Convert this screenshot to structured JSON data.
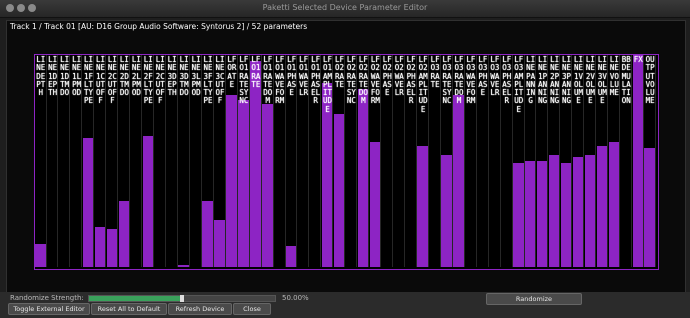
{
  "window": {
    "title": "Paketti Selected Device Parameter Editor"
  },
  "track_label": "Track 1 / Track 01 [AU: D16 Group Audio Software: Syntorus 2] / 52 parameters",
  "colors": {
    "accent": "#8d24c4",
    "background": "#000000",
    "slider_fill": "#3aa15b"
  },
  "parameters": [
    {
      "label": "LINE DEPTH",
      "value": 0.11
    },
    {
      "label": "LINE 1 DEPTH",
      "value": 0.0
    },
    {
      "label": "LINE 1 DTMDO",
      "value": 0.0
    },
    {
      "label": "LINE 1 LP MOD",
      "value": 0.0
    },
    {
      "label": "LINE 1 FLT TYPE",
      "value": 0.61
    },
    {
      "label": "LINE 1 CUTOFF",
      "value": 0.19
    },
    {
      "label": "LINE 2 CUTOFF",
      "value": 0.18
    },
    {
      "label": "LINE 2 DTMDO",
      "value": 0.31
    },
    {
      "label": "LINE 2 LP MOD",
      "value": 0.0
    },
    {
      "label": "LINE 2 FLT TYPE",
      "value": 0.62
    },
    {
      "label": "LINE 2 CUTOFF",
      "value": 0.0
    },
    {
      "label": "LINE 3 DEPTH",
      "value": 0.0
    },
    {
      "label": "LINE 3 DTMDO",
      "value": 0.01
    },
    {
      "label": "LINE 3 LP MOD",
      "value": 0.0
    },
    {
      "label": "LINE 3 FLT TYPE",
      "value": 0.31
    },
    {
      "label": "LINE 3 CUTOFF",
      "value": 0.22
    },
    {
      "label": "LFO RATE",
      "value": 0.81
    },
    {
      "label": "LFO 1 RATE SYNC",
      "value": 0.79
    },
    {
      "label": "LFO 1 RATE",
      "value": 0.97
    },
    {
      "label": "LFO 1 RATE DOM",
      "value": 0.77
    },
    {
      "label": "LFO 1 WAVEFORM",
      "value": 0.0
    },
    {
      "label": "LFO 1 PHASE",
      "value": 0.1
    },
    {
      "label": "LFO 1 WAVE LR",
      "value": 0.0
    },
    {
      "label": "LFO 1 PHASE LR",
      "value": 0.0
    },
    {
      "label": "LFO 1 AMPLITUDE",
      "value": 0.87
    },
    {
      "label": "LFO 2 RATE",
      "value": 0.72
    },
    {
      "label": "LFO 2 RATE SYNC",
      "value": 0.0
    },
    {
      "label": "LFO 2 RATE DOM",
      "value": 0.84
    },
    {
      "label": "LFO 2 WAVEFORM",
      "value": 0.59
    },
    {
      "label": "LFO 2 PHASE",
      "value": 0.0
    },
    {
      "label": "LFO 2 WAVE LR",
      "value": 0.0
    },
    {
      "label": "LFO 2 PHASE LR",
      "value": 0.0
    },
    {
      "label": "LFO 2 AMPLITUDE",
      "value": 0.57
    },
    {
      "label": "LFO 3 RATE",
      "value": 0.0
    },
    {
      "label": "LFO 3 RATE SYNC",
      "value": 0.53
    },
    {
      "label": "LFO 3 RATE DOM",
      "value": 0.81
    },
    {
      "label": "LFO 3 WAVEFORM",
      "value": 0.0
    },
    {
      "label": "LFO 3 PHASE",
      "value": 0.0
    },
    {
      "label": "LFO 3 WAVE LR",
      "value": 0.0
    },
    {
      "label": "LFO 3 PHASE LR",
      "value": 0.0
    },
    {
      "label": "LFO 3 AMPLITUDE",
      "value": 0.49
    },
    {
      "label": "LINE PANNING",
      "value": 0.5
    },
    {
      "label": "LINE 1 PANNING",
      "value": 0.5
    },
    {
      "label": "LINE 2 PANNING",
      "value": 0.53
    },
    {
      "label": "LINE 3 PANNING",
      "value": 0.49
    },
    {
      "label": "LINE 1 VOLUME",
      "value": 0.52
    },
    {
      "label": "LINE 2 VOLUME",
      "value": 0.53
    },
    {
      "label": "LINE 3 VOLUME",
      "value": 0.57
    },
    {
      "label": "LINE VOLUME",
      "value": 0.59
    },
    {
      "label": "BBD EMULATION",
      "value": 0.0
    },
    {
      "label": "FX",
      "value": 1.0
    },
    {
      "label": "OUTPUT VOLUME",
      "value": 0.56
    }
  ],
  "randomize": {
    "label": "Randomize Strength:",
    "value_text": "50.00%",
    "value": 0.5,
    "button": "Randomize"
  },
  "buttons": {
    "toggle_external": "Toggle External Editor",
    "reset_all": "Reset All to Default",
    "refresh": "Refresh Device",
    "close": "Close"
  }
}
